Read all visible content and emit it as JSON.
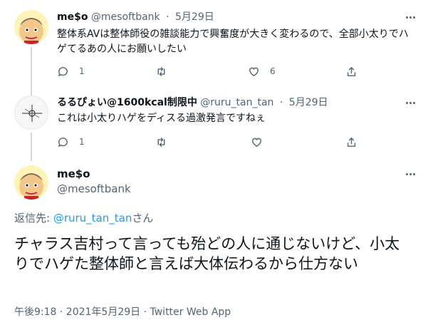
{
  "tweet1": {
    "name": "me$o",
    "handle": "@mesoftbank",
    "separator": "·",
    "date": "5月29日",
    "text": "整体系AVは整体師役の雑談能力で興奮度が大きく変わるので、全部小太りでハゲてるあの人にお願いしたい",
    "reply_count": "1",
    "like_count": "6"
  },
  "tweet2": {
    "name": "るるぴょい@1600kcal制限中",
    "handle": "@ruru_tan_tan",
    "separator": "·",
    "date": "5月29日",
    "text": "これは小太りハゲをディスる過激発言ですねぇ",
    "reply_count": "1"
  },
  "focus": {
    "name": "me$o",
    "handle": "@mesoftbank",
    "reply_prefix": "返信先: ",
    "reply_target": "@ruru_tan_tan",
    "reply_suffix": "さん",
    "text": "チャラス吉村って言っても殆どの人に通じないけど、小太りでハゲた整体師と言えば大体伝わるから仕方ない",
    "meta": "午後9:18 · 2021年5月29日 · Twitter Web App"
  },
  "icons": {
    "reply": "speech-bubble-icon",
    "retweet": "retweet-icon",
    "like": "heart-icon",
    "share": "share-icon",
    "more": "more-dots-icon"
  },
  "colors": {
    "text": "#0f1419",
    "secondary": "#536471",
    "link": "#1d9bf0",
    "thread_line": "#cfd9de"
  }
}
